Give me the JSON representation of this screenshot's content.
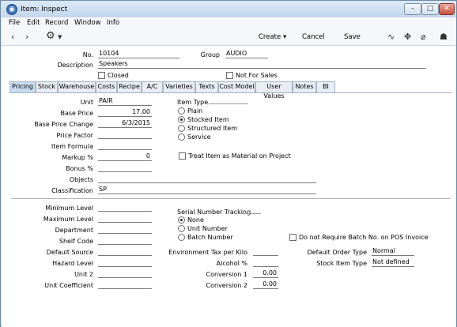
{
  "window": {
    "title": "Item: Inspect"
  },
  "menubar": [
    "File",
    "Edit",
    "Record",
    "Window",
    "Info"
  ],
  "toolbar": {
    "create_label": "Create",
    "cancel_label": "Cancel",
    "save_label": "Save"
  },
  "header": {
    "no_label": "No.",
    "no_value": "10104",
    "group_label": "Group",
    "group_value": "AUDIO",
    "description_label": "Description",
    "description_value": "Speakers",
    "closed_label": "Closed",
    "not_for_sales_label": "Not For Sales"
  },
  "tabs": [
    "Pricing",
    "Stock",
    "Warehouse",
    "Costs",
    "Recipe",
    "A/C",
    "Varieties",
    "Texts",
    "Cost Model",
    "User Values",
    "Notes",
    "BI"
  ],
  "pricing": {
    "unit_label": "Unit",
    "unit_value": "PAIR",
    "base_price_label": "Base Price",
    "base_price_value": "17.00",
    "base_price_change_label": "Base Price Change",
    "base_price_change_value": "6/3/2015",
    "price_factor_label": "Price Factor",
    "price_factor_value": "",
    "item_formula_label": "Item Formula",
    "item_formula_value": "",
    "markup_label": "Markup %",
    "markup_value": "0",
    "bonus_label": "Bonus %",
    "bonus_value": "",
    "objects_label": "Objects",
    "objects_value": "",
    "classification_label": "Classification",
    "classification_value": "SP",
    "item_type_label": "Item Type",
    "item_type_options": [
      {
        "label": "Plain",
        "selected": false
      },
      {
        "label": "Stocked Item",
        "selected": true
      },
      {
        "label": "Structured Item",
        "selected": false
      },
      {
        "label": "Service",
        "selected": false
      }
    ],
    "treat_material_label": "Treat Item as Material on Project"
  },
  "stock": {
    "min_level_label": "Minimum Level",
    "max_level_label": "Maximum Level",
    "department_label": "Department",
    "shelf_code_label": "Shelf Code",
    "default_source_label": "Default Source",
    "hazard_level_label": "Hazard Level",
    "unit2_label": "Unit 2",
    "unit_coeff_label": "Unit Coefficient",
    "serial_label": "Serial Number Tracking",
    "serial_options": [
      {
        "label": "None",
        "selected": true
      },
      {
        "label": "Unit Number",
        "selected": false
      },
      {
        "label": "Batch Number",
        "selected": false
      }
    ],
    "batch_pos_label": "Do not Require Batch No. on POS Invoice",
    "env_tax_label": "Environment Tax per Kilo",
    "env_tax_value": "",
    "alcohol_label": "Alcohol %",
    "alcohol_value": "",
    "conv1_label": "Conversion 1",
    "conv1_value": "0.00",
    "conv2_label": "Conversion 2",
    "conv2_value": "0.00",
    "default_order_type_label": "Default Order Type",
    "default_order_type_value": "Normal",
    "stock_item_type_label": "Stock Item Type",
    "stock_item_type_value": "Not defined"
  }
}
